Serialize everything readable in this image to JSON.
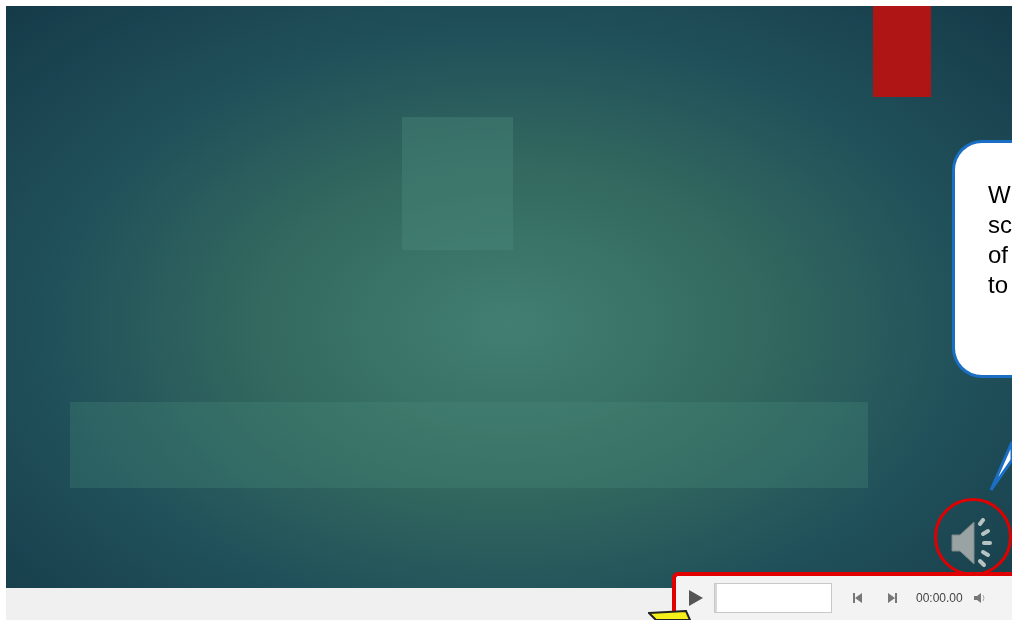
{
  "callout": {
    "lines": [
      "W",
      "sc",
      "of",
      "to"
    ]
  },
  "audio_controls": {
    "time": "00:00.00",
    "progress": {
      "level": 0
    }
  }
}
